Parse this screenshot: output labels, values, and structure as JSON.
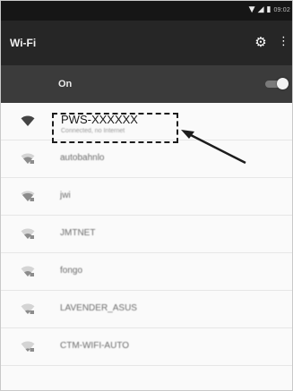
{
  "status_bar": {
    "icons": [
      "wifi-icon",
      "signal-icon",
      "battery-icon"
    ],
    "time": "09:02"
  },
  "toolbar": {
    "title": "Wi-Fi",
    "settings_icon": "gear-icon",
    "more_icon": "more-vert-icon"
  },
  "wifi_switch": {
    "label": "On",
    "enabled": true
  },
  "networks": [
    {
      "name": "PWS-XXXXXX",
      "status": "Connected, no Internet",
      "icon": "wifi-full-icon",
      "connected": true
    },
    {
      "name": "autobahnlo",
      "icon": "wifi-secure-icon"
    },
    {
      "name": "jwi",
      "icon": "wifi-secure-icon"
    },
    {
      "name": "JMTNET",
      "icon": "wifi-secure-icon"
    },
    {
      "name": "fongo",
      "icon": "wifi-secure-icon"
    },
    {
      "name": "LAVENDER_ASUS",
      "icon": "wifi-secure-icon"
    },
    {
      "name": "CTM-WIFI-AUTO",
      "icon": "wifi-secure-icon"
    }
  ],
  "colors": {
    "status_bar": "#161616",
    "toolbar": "#262626",
    "switch_bar": "#3b3b3b",
    "list_background": "#fafafa",
    "annotation": "#1c1c1c"
  }
}
